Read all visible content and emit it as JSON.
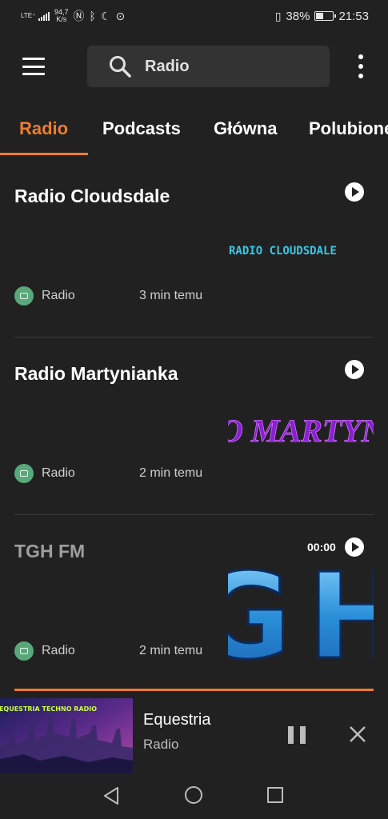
{
  "status_bar": {
    "network_type": "LTE⁺",
    "network_speed": "94,7",
    "network_speed_unit": "K/s",
    "battery_percent": "38%",
    "time": "21:53"
  },
  "appbar": {
    "search_text": "Radio"
  },
  "tabs": [
    {
      "label": "Radio",
      "active": true
    },
    {
      "label": "Podcasts",
      "active": false
    },
    {
      "label": "Główna",
      "active": false
    },
    {
      "label": "Polubione",
      "active": false
    }
  ],
  "stations": [
    {
      "title": "Radio Cloudsdale",
      "category": "Radio",
      "time": "3 min temu",
      "duration": "",
      "logo_text": "RADIO CLOUDSDALE"
    },
    {
      "title": "Radio Martynianka",
      "category": "Radio",
      "time": "2 min temu",
      "duration": "",
      "logo_text": "O MARTYN"
    },
    {
      "title": "TGH FM",
      "category": "Radio",
      "time": "2 min temu",
      "duration": "00:00",
      "logo_text": "GH"
    }
  ],
  "player": {
    "title": "Equestria",
    "subtitle": "Radio",
    "art_text": "EQUESTRIA TECHNO RADIO",
    "accent_color": "#ee7c2c"
  },
  "colors": {
    "accent": "#ee7c2c",
    "background": "#212121",
    "meta_icon": "#5aa87a"
  }
}
